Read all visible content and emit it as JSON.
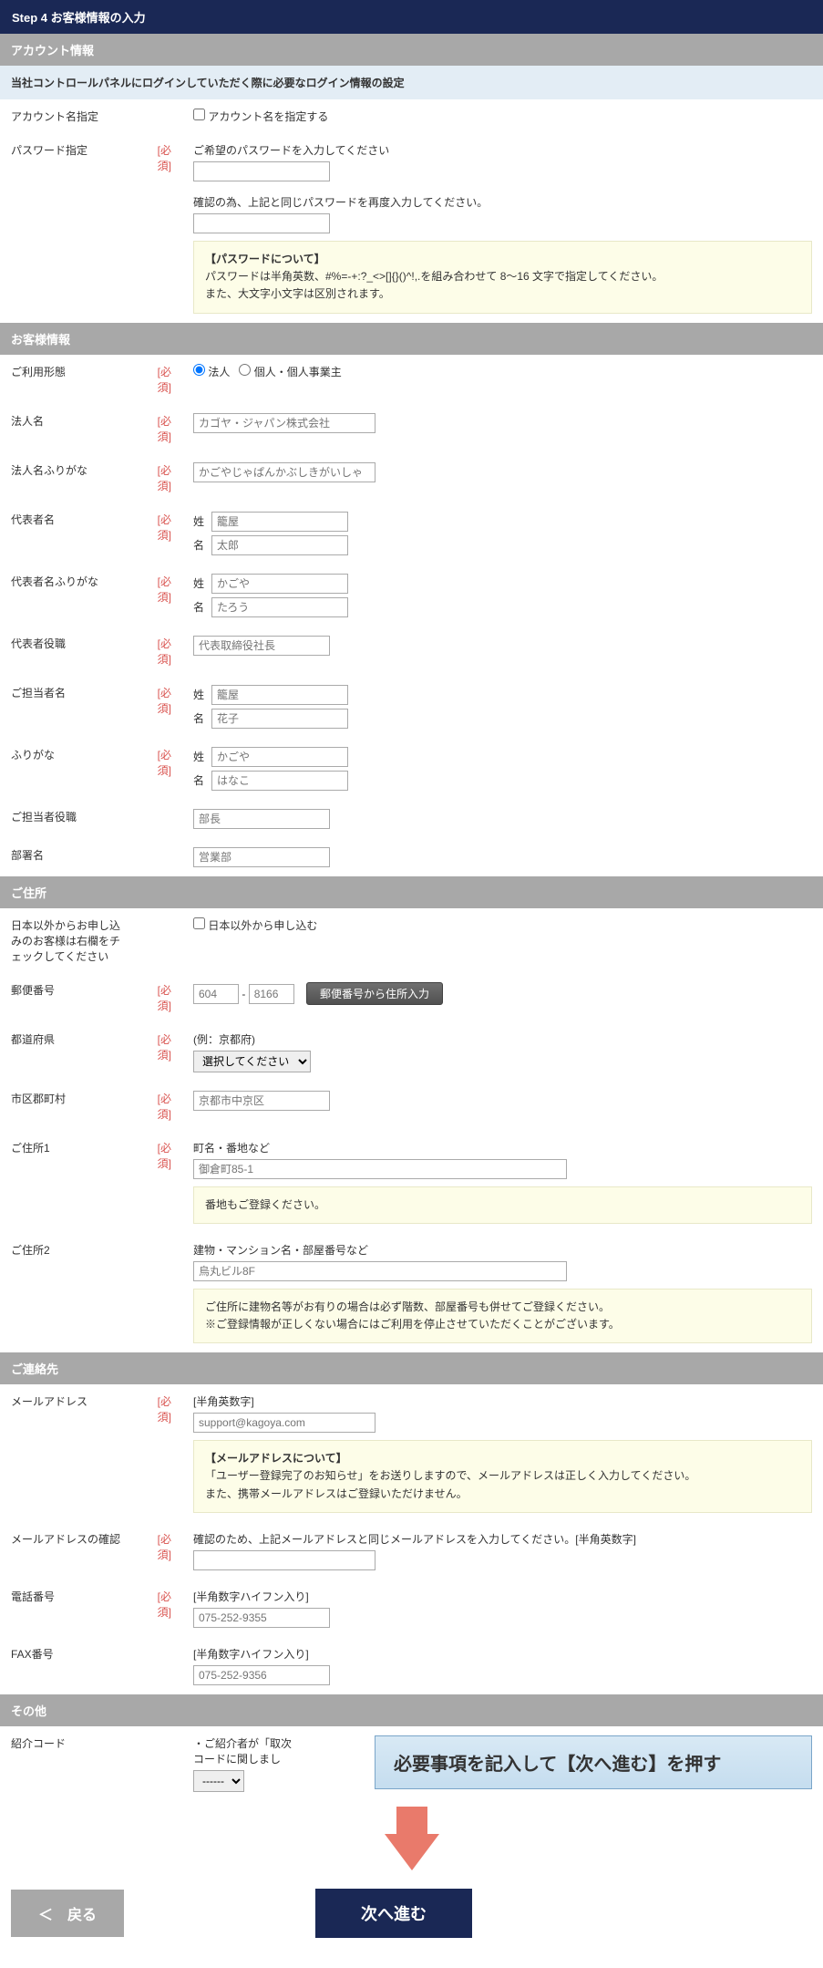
{
  "step_header": "Step 4 お客様情報の入力",
  "required_label": "[必須]",
  "account": {
    "section_title": "アカウント情報",
    "info_bar": "当社コントロールパネルにログインしていただく際に必要なログイン情報の設定",
    "account_name_label": "アカウント名指定",
    "account_name_checkbox": "アカウント名を指定する",
    "password_label": "パスワード指定",
    "password_hint1": "ご希望のパスワードを入力してください",
    "password_hint2": "確認の為、上記と同じパスワードを再度入力してください。",
    "password_note_title": "【パスワードについて】",
    "password_note1": "パスワードは半角英数、#%=-+:?_<>[]{}()^!,.を組み合わせて 8～16 文字で指定してください。",
    "password_note2": "また、大文字小文字は区別されます。"
  },
  "customer": {
    "section_title": "お客様情報",
    "usage_type_label": "ご利用形態",
    "usage_corp": "法人",
    "usage_indiv": "個人・個人事業主",
    "corp_name_label": "法人名",
    "corp_name_ph": "カゴヤ・ジャパン株式会社",
    "corp_kana_label": "法人名ふりがな",
    "corp_kana_ph": "かごやじゃぱんかぶしきがいしゃ",
    "rep_name_label": "代表者名",
    "sei_label": "姓",
    "mei_label": "名",
    "rep_sei_ph": "籠屋",
    "rep_mei_ph": "太郎",
    "rep_kana_label": "代表者名ふりがな",
    "rep_sei_kana_ph": "かごや",
    "rep_mei_kana_ph": "たろう",
    "rep_title_label": "代表者役職",
    "rep_title_ph": "代表取締役社長",
    "contact_name_label": "ご担当者名",
    "contact_sei_ph": "籠屋",
    "contact_mei_ph": "花子",
    "contact_kana_label": "ふりがな",
    "contact_sei_kana_ph": "かごや",
    "contact_mei_kana_ph": "はなこ",
    "contact_title_label": "ご担当者役職",
    "contact_title_ph": "部長",
    "dept_label": "部署名",
    "dept_ph": "営業部"
  },
  "address": {
    "section_title": "ご住所",
    "overseas_label": "日本以外からお申し込みのお客様は右欄をチェックしてください",
    "overseas_checkbox": "日本以外から申し込む",
    "zip_label": "郵便番号",
    "zip1_ph": "604",
    "zip_sep": "-",
    "zip2_ph": "8166",
    "zip_btn": "郵便番号から住所入力",
    "pref_label": "都道府県",
    "pref_hint": "(例：京都府)",
    "pref_select": "選択してください",
    "city_label": "市区郡町村",
    "city_ph": "京都市中京区",
    "addr1_label": "ご住所1",
    "addr1_hint": "町名・番地など",
    "addr1_ph": "御倉町85-1",
    "addr1_note": "番地もご登録ください。",
    "addr2_label": "ご住所2",
    "addr2_hint": "建物・マンション名・部屋番号など",
    "addr2_ph": "烏丸ビル8F",
    "addr2_note1": "ご住所に建物名等がお有りの場合は必ず階数、部屋番号も併せてご登録ください。",
    "addr2_note2": "※ご登録情報が正しくない場合にはご利用を停止させていただくことがございます。"
  },
  "contact": {
    "section_title": "ご連絡先",
    "email_label": "メールアドレス",
    "email_hint": "[半角英数字]",
    "email_ph": "support@kagoya.com",
    "email_note_title": "【メールアドレスについて】",
    "email_note1": "「ユーザー登録完了のお知らせ」をお送りしますので、メールアドレスは正しく入力してください。",
    "email_note2": "また、携帯メールアドレスはご登録いただけません。",
    "email_confirm_label": "メールアドレスの確認",
    "email_confirm_hint": "確認のため、上記メールアドレスと同じメールアドレスを入力してください。[半角英数字]",
    "tel_label": "電話番号",
    "tel_hint": "[半角数字ハイフン入り]",
    "tel_ph": "075-252-9355",
    "fax_label": "FAX番号",
    "fax_hint": "[半角数字ハイフン入り]",
    "fax_ph": "075-252-9356"
  },
  "other": {
    "section_title": "その他",
    "referral_label": "紹介コード",
    "referral_text": "・ご紹介者が「取次",
    "referral_text2": "コードに関しまし",
    "referral_select": "------"
  },
  "callout": "必要事項を記入して【次へ進む】を押す",
  "btn_back": "＜　戻る",
  "btn_next": "次へ進む"
}
